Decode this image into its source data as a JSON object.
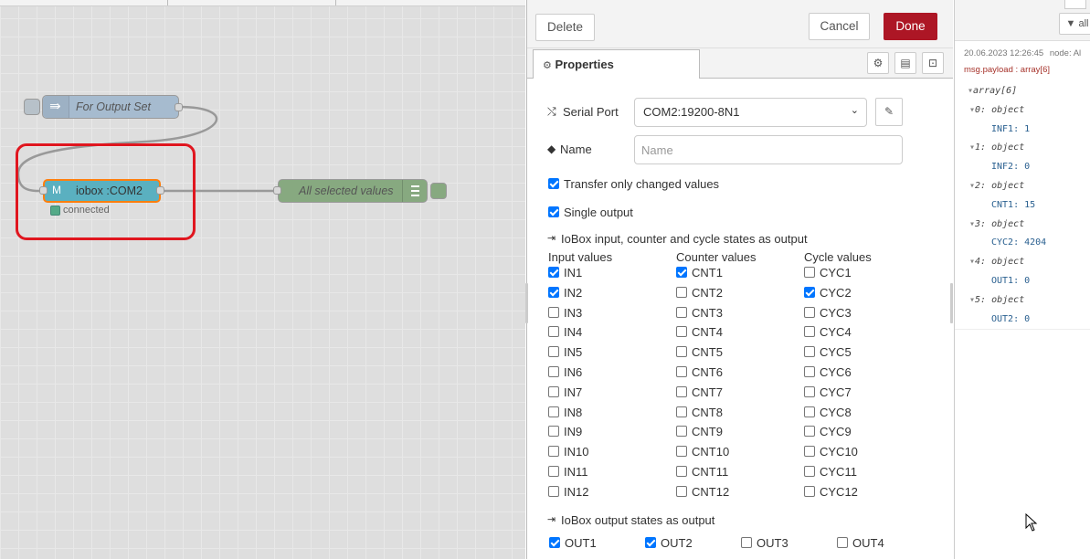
{
  "canvas": {
    "nodes": {
      "inject": {
        "label": "For Output Set"
      },
      "iobox": {
        "label": "iobox :COM2",
        "icon_text": "M",
        "status": "connected"
      },
      "debug": {
        "label": "All selected values"
      }
    },
    "highlight_color": "#e0161f"
  },
  "editor": {
    "delete_label": "Delete",
    "cancel_label": "Cancel",
    "done_label": "Done",
    "tab_properties": "Properties",
    "serial_port": {
      "label": "Serial Port",
      "value": "COM2:19200-8N1"
    },
    "name": {
      "label": "Name",
      "placeholder": "Name"
    },
    "transfer_only_changed": {
      "label": "Transfer only changed values",
      "checked": true
    },
    "single_output": {
      "label": "Single output",
      "checked": true
    },
    "iobox_section": "IoBox input, counter and cycle states as output",
    "columns": {
      "input": "Input values",
      "counter": "Counter values",
      "cycle": "Cycle values"
    },
    "inputs": [
      {
        "label": "IN1",
        "checked": true
      },
      {
        "label": "IN2",
        "checked": true
      },
      {
        "label": "IN3",
        "checked": false
      },
      {
        "label": "IN4",
        "checked": false
      },
      {
        "label": "IN5",
        "checked": false
      },
      {
        "label": "IN6",
        "checked": false
      },
      {
        "label": "IN7",
        "checked": false
      },
      {
        "label": "IN8",
        "checked": false
      },
      {
        "label": "IN9",
        "checked": false
      },
      {
        "label": "IN10",
        "checked": false
      },
      {
        "label": "IN11",
        "checked": false
      },
      {
        "label": "IN12",
        "checked": false
      }
    ],
    "counters": [
      {
        "label": "CNT1",
        "checked": true
      },
      {
        "label": "CNT2",
        "checked": false
      },
      {
        "label": "CNT3",
        "checked": false
      },
      {
        "label": "CNT4",
        "checked": false
      },
      {
        "label": "CNT5",
        "checked": false
      },
      {
        "label": "CNT6",
        "checked": false
      },
      {
        "label": "CNT7",
        "checked": false
      },
      {
        "label": "CNT8",
        "checked": false
      },
      {
        "label": "CNT9",
        "checked": false
      },
      {
        "label": "CNT10",
        "checked": false
      },
      {
        "label": "CNT11",
        "checked": false
      },
      {
        "label": "CNT12",
        "checked": false
      }
    ],
    "cycles": [
      {
        "label": "CYC1",
        "checked": false
      },
      {
        "label": "CYC2",
        "checked": true
      },
      {
        "label": "CYC3",
        "checked": false
      },
      {
        "label": "CYC4",
        "checked": false
      },
      {
        "label": "CYC5",
        "checked": false
      },
      {
        "label": "CYC6",
        "checked": false
      },
      {
        "label": "CYC7",
        "checked": false
      },
      {
        "label": "CYC8",
        "checked": false
      },
      {
        "label": "CYC9",
        "checked": false
      },
      {
        "label": "CYC10",
        "checked": false
      },
      {
        "label": "CYC11",
        "checked": false
      },
      {
        "label": "CYC12",
        "checked": false
      }
    ],
    "output_section": "IoBox output states as output",
    "outputs": [
      {
        "label": "OUT1",
        "checked": true
      },
      {
        "label": "OUT2",
        "checked": true
      },
      {
        "label": "OUT3",
        "checked": false
      },
      {
        "label": "OUT4",
        "checked": false
      }
    ]
  },
  "debug_panel": {
    "filter_label": "all",
    "timestamp": "20.06.2023 12:26:45",
    "node_text": "node: Al",
    "payload_label": "msg.payload : array[6]",
    "tree": [
      {
        "text": "array[6]",
        "kind": "head"
      },
      {
        "text": "0: object",
        "kind": "obj"
      },
      {
        "text": "INF1: 1",
        "kind": "val"
      },
      {
        "text": "1: object",
        "kind": "obj"
      },
      {
        "text": "INF2: 0",
        "kind": "val"
      },
      {
        "text": "2: object",
        "kind": "obj"
      },
      {
        "text": "CNT1: 15",
        "kind": "val"
      },
      {
        "text": "3: object",
        "kind": "obj"
      },
      {
        "text": "CYC2: 4204",
        "kind": "val"
      },
      {
        "text": "4: object",
        "kind": "obj"
      },
      {
        "text": "OUT1: 0",
        "kind": "val"
      },
      {
        "text": "5: object",
        "kind": "obj"
      },
      {
        "text": "OUT2: 0",
        "kind": "val"
      }
    ]
  }
}
